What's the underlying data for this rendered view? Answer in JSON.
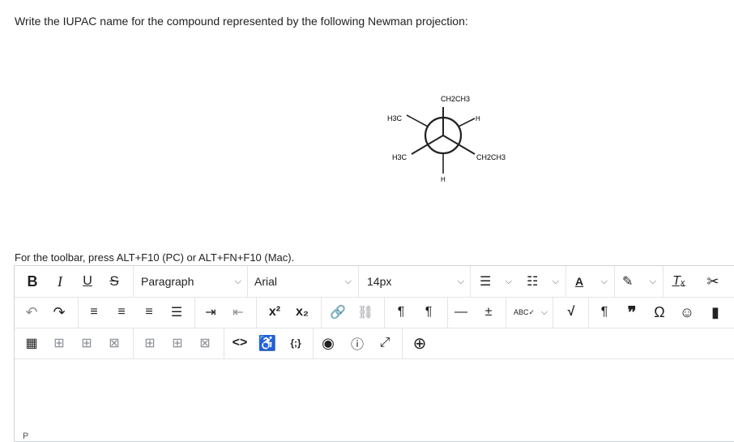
{
  "question": "Write the IUPAC name for the compound represented by the following Newman projection:",
  "newman": {
    "top": "CH2CH3",
    "upper_left": "H3C",
    "upper_right": "H",
    "lower_left": "H3C",
    "lower_right": "CH2CH3",
    "bottom": "H"
  },
  "hint": "For the toolbar, press ALT+F10 (PC) or ALT+FN+F10 (Mac).",
  "toolbar": {
    "bold": "B",
    "italic": "I",
    "underline": "U",
    "strike": "S",
    "paragraph": "Paragraph",
    "font": "Arial",
    "size": "14px",
    "omega": "Ω"
  },
  "status": {
    "path": "P"
  }
}
